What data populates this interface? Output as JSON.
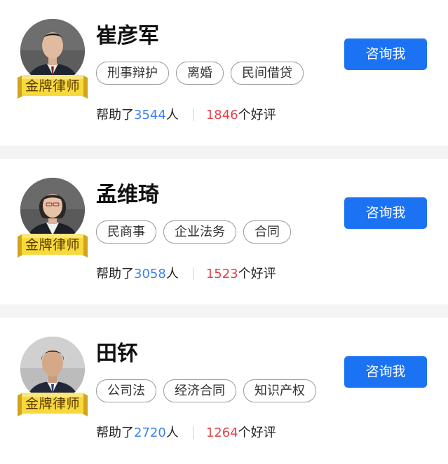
{
  "lawyers": [
    {
      "name": "崔彦军",
      "badge": "金牌律师",
      "tags": [
        "刑事辩护",
        "离婚",
        "民间借贷"
      ],
      "helped_prefix": "帮助了",
      "helped_count": "3544",
      "helped_suffix": "人",
      "reviews_count": "1846",
      "reviews_suffix": "个好评",
      "button": "咨询我"
    },
    {
      "name": "孟维琦",
      "badge": "金牌律师",
      "tags": [
        "民商事",
        "企业法务",
        "合同"
      ],
      "helped_prefix": "帮助了",
      "helped_count": "3058",
      "helped_suffix": "人",
      "reviews_count": "1523",
      "reviews_suffix": "个好评",
      "button": "咨询我"
    },
    {
      "name": "田钚",
      "badge": "金牌律师",
      "tags": [
        "公司法",
        "经济合同",
        "知识产权"
      ],
      "helped_prefix": "帮助了",
      "helped_count": "2720",
      "helped_suffix": "人",
      "reviews_count": "1264",
      "reviews_suffix": "个好评",
      "button": "咨询我"
    }
  ],
  "colors": {
    "accent_blue": "#1b73f4",
    "count_blue": "#3e82f1",
    "review_red": "#e2414b",
    "badge_gold": "#f5d53a",
    "separator_gray": "#f4f4f4"
  },
  "icons": [
    "lawyer-avatar",
    "gold-badge-ribbon"
  ]
}
